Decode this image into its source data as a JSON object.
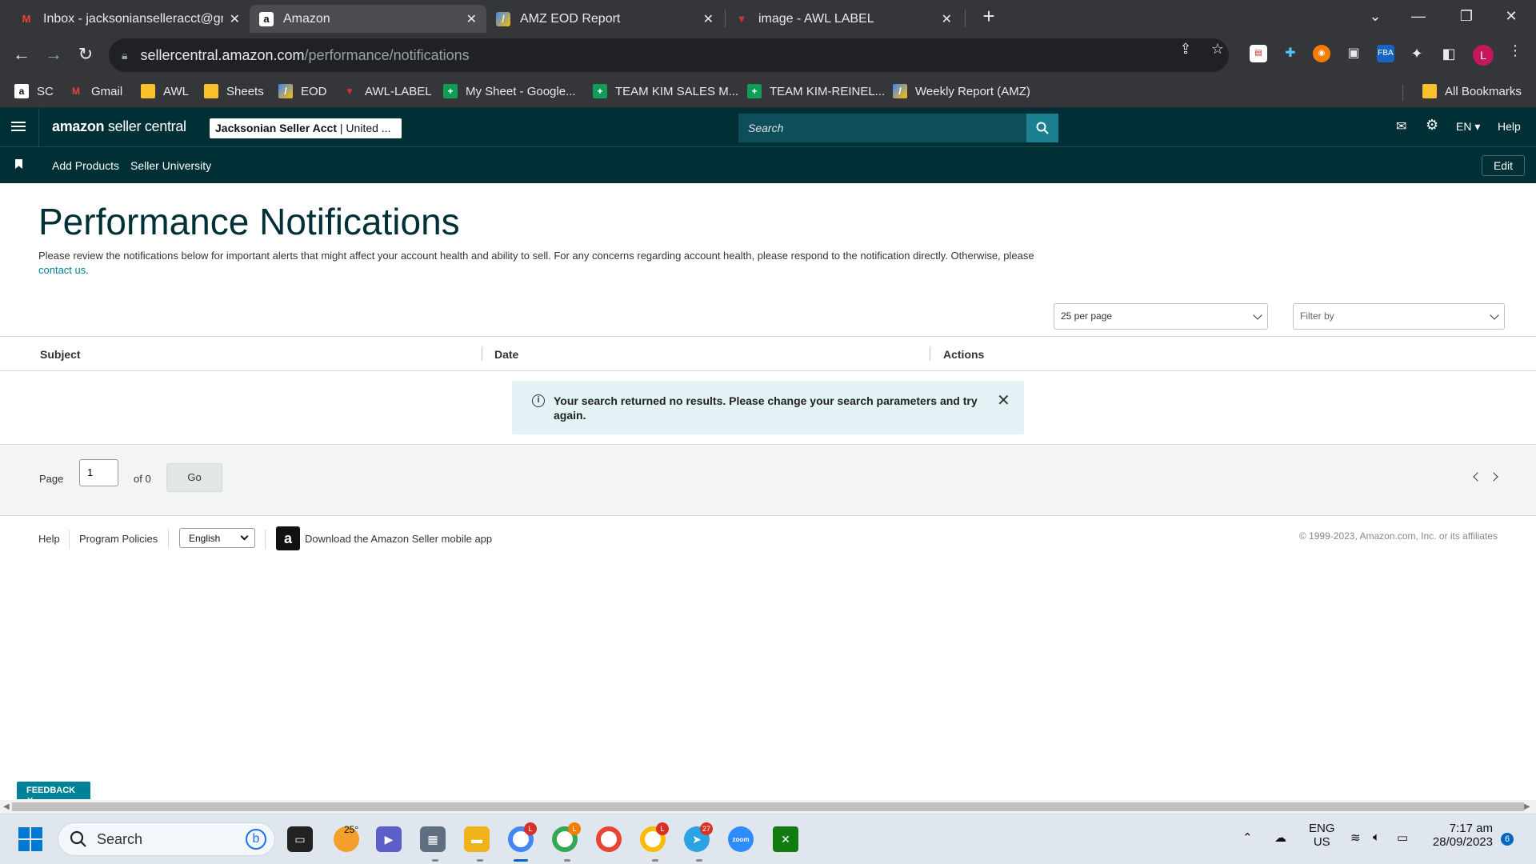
{
  "browser": {
    "tabs": [
      {
        "title": "Inbox - jacksonianselleracct@gm",
        "icon": "gmail-icon",
        "active": false
      },
      {
        "title": "Amazon",
        "icon": "amazon-icon",
        "active": true
      },
      {
        "title": "AMZ EOD Report",
        "icon": "report-icon",
        "active": false
      },
      {
        "title": "image - AWL LABEL",
        "icon": "awl-icon",
        "active": false
      }
    ],
    "url_host": "sellercentral.amazon.com",
    "url_path": "/performance/notifications",
    "profile_initial": "L",
    "bookmarks": [
      {
        "label": "SC"
      },
      {
        "label": "Gmail"
      },
      {
        "label": "AWL"
      },
      {
        "label": "Sheets"
      },
      {
        "label": "EOD"
      },
      {
        "label": "AWL-LABEL"
      },
      {
        "label": "My Sheet - Google..."
      },
      {
        "label": "TEAM KIM SALES M..."
      },
      {
        "label": "TEAM KIM-REINEL..."
      },
      {
        "label": "Weekly Report (AMZ)"
      },
      {
        "label": "All Bookmarks"
      }
    ]
  },
  "seller_header": {
    "logo_bold": "amazon",
    "logo_rest": " seller central",
    "account_name": "Jacksonian Seller Acct",
    "account_region": " | United ...",
    "search_placeholder": "Search",
    "language": "EN",
    "help": "Help"
  },
  "subnav": {
    "links": [
      "Add Products",
      "Seller University"
    ],
    "edit": "Edit"
  },
  "page": {
    "title": "Performance Notifications",
    "description": "Please review the notifications below for important alerts that might affect your account health and ability to sell. For any concerns regarding account health, please respond to the notification directly. Otherwise, please ",
    "contact_link": "contact us",
    "description_end": ".",
    "per_page": "25 per page",
    "filter_placeholder": "Filter by",
    "columns": [
      "Subject",
      "Date",
      "Actions"
    ],
    "alert_message": "Your search returned no results. Please change your search parameters and try again.",
    "pager": {
      "page_label": "Page",
      "current_page": "1",
      "of_label": "of 0",
      "go": "Go"
    }
  },
  "footer": {
    "help": "Help",
    "policies": "Program Policies",
    "language": "English",
    "app_link": "Download the Amazon Seller mobile app",
    "copyright": "© 1999-2023, Amazon.com, Inc. or its affiliates"
  },
  "feedback": "FEEDBACK",
  "taskbar": {
    "search": "Search",
    "weather": "25°",
    "lang_top": "ENG",
    "lang_bottom": "US",
    "time": "7:17 am",
    "date": "28/09/2023",
    "notifications": "6",
    "telegram_badge": "27"
  },
  "colors": {
    "header_bg": "#002f36",
    "accent": "#008296",
    "title": "#002f36"
  }
}
